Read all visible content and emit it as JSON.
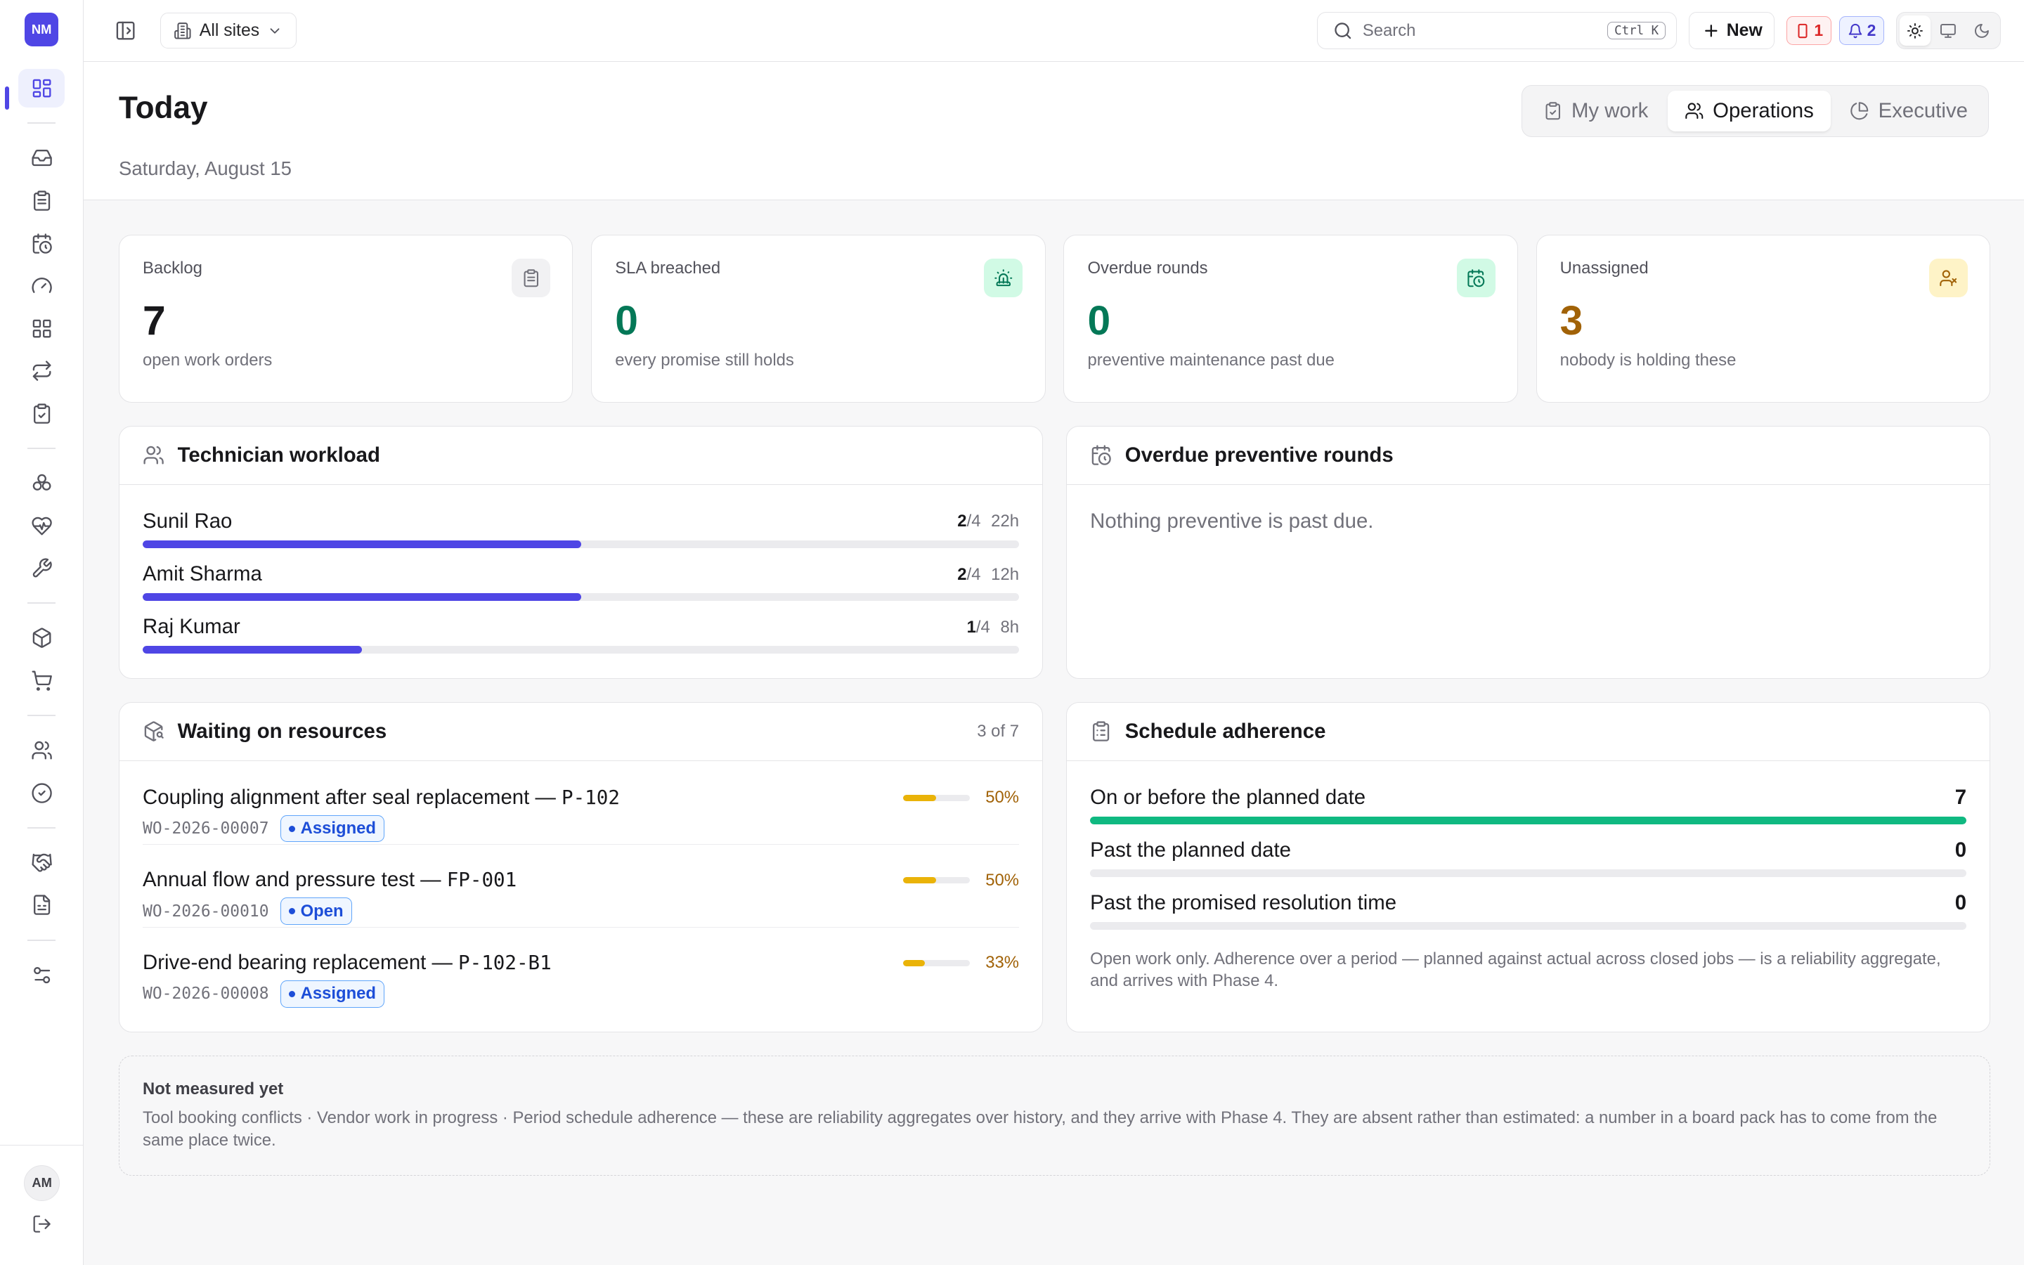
{
  "brand": {
    "initials": "NM",
    "color": "#4f46e5"
  },
  "sidebar": {
    "items": [
      {
        "icon": "dashboard-icon",
        "active": true
      },
      {
        "icon": "inbox-icon"
      },
      {
        "icon": "clipboard-icon"
      },
      {
        "icon": "calendar-clock-icon"
      },
      {
        "icon": "gauge-icon"
      },
      {
        "icon": "grid-icon"
      },
      {
        "icon": "repeat-icon"
      },
      {
        "icon": "clipboard-check-icon"
      },
      {
        "icon": "boxes-icon"
      },
      {
        "icon": "heart-pulse-icon"
      },
      {
        "icon": "wrench-icon"
      },
      {
        "icon": "package-icon"
      },
      {
        "icon": "cart-icon"
      },
      {
        "icon": "users-icon"
      },
      {
        "icon": "check-circle-icon"
      },
      {
        "icon": "handshake-icon"
      },
      {
        "icon": "document-icon"
      },
      {
        "icon": "sliders-icon"
      }
    ],
    "user_initials": "AM"
  },
  "topbar": {
    "site_selector": "All sites",
    "search_placeholder": "Search",
    "search_shortcut": "Ctrl K",
    "new_label": "New",
    "alert_count": "1",
    "notification_count": "2",
    "theme_selected": "light"
  },
  "header": {
    "title": "Today",
    "date": "Saturday, August 15",
    "tabs": [
      {
        "label": "My work",
        "icon": "clipboard-icon",
        "active": false
      },
      {
        "label": "Operations",
        "icon": "users-icon",
        "active": true
      },
      {
        "label": "Executive",
        "icon": "pie-chart-icon",
        "active": false
      }
    ]
  },
  "kpis": [
    {
      "label": "Backlog",
      "value": "7",
      "sub": "open work orders",
      "icon": "clipboard-icon",
      "value_color": "#18181b",
      "icon_bg": "#f1f1f3",
      "icon_color": "#71717a"
    },
    {
      "label": "SLA breached",
      "value": "0",
      "sub": "every promise still holds",
      "icon": "siren-icon",
      "value_color": "#047857",
      "icon_bg": "#d1fae5",
      "icon_color": "#047857"
    },
    {
      "label": "Overdue rounds",
      "value": "0",
      "sub": "preventive maintenance past due",
      "icon": "calendar-clock-icon",
      "value_color": "#047857",
      "icon_bg": "#d1fae5",
      "icon_color": "#047857"
    },
    {
      "label": "Unassigned",
      "value": "3",
      "sub": "nobody is holding these",
      "icon": "user-x-icon",
      "value_color": "#a16207",
      "icon_bg": "#fef3c7",
      "icon_color": "#a16207"
    }
  ],
  "workload": {
    "title": "Technician workload",
    "rows": [
      {
        "name": "Sunil Rao",
        "assigned": "2",
        "capacity": "/4",
        "hours": "22h",
        "ratio": 0.5
      },
      {
        "name": "Amit Sharma",
        "assigned": "2",
        "capacity": "/4",
        "hours": "12h",
        "ratio": 0.5
      },
      {
        "name": "Raj Kumar",
        "assigned": "1",
        "capacity": "/4",
        "hours": "8h",
        "ratio": 0.25
      }
    ]
  },
  "overdue_rounds": {
    "title": "Overdue preventive rounds",
    "empty": "Nothing preventive is past due."
  },
  "waiting": {
    "title": "Waiting on resources",
    "count": "3 of 7",
    "rows": [
      {
        "title": "Coupling alignment after seal replacement — ",
        "asset": "P-102",
        "wo": "WO-2026-00007",
        "status": "Assigned",
        "percent": "50%",
        "ratio": 0.5
      },
      {
        "title": "Annual flow and pressure test — ",
        "asset": "FP-001",
        "wo": "WO-2026-00010",
        "status": "Open",
        "percent": "50%",
        "ratio": 0.5
      },
      {
        "title": "Drive-end bearing replacement — ",
        "asset": "P-102-B1",
        "wo": "WO-2026-00008",
        "status": "Assigned",
        "percent": "33%",
        "ratio": 0.33
      }
    ]
  },
  "adherence": {
    "title": "Schedule adherence",
    "rows": [
      {
        "label": "On or before the planned date",
        "value": "7",
        "ratio": 1
      },
      {
        "label": "Past the planned date",
        "value": "0",
        "ratio": 0
      },
      {
        "label": "Past the promised resolution time",
        "value": "0",
        "ratio": 0
      }
    ],
    "note": "Open work only. Adherence over a period — planned against actual across closed jobs — is a reliability aggregate, and arrives with Phase 4."
  },
  "not_measured": {
    "title": "Not measured yet",
    "text": "Tool booking conflicts · Vendor work in progress · Period schedule adherence — these are reliability aggregates over history, and they arrive with Phase 4. They are absent rather than estimated: a number in a board pack has to come from the same place twice."
  }
}
